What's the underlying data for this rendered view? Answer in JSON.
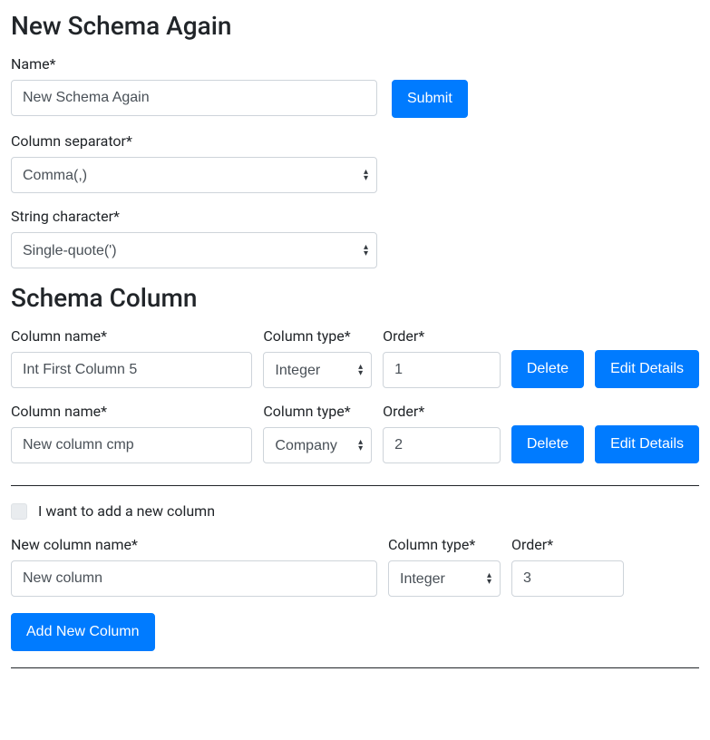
{
  "header": {
    "title": "New Schema Again"
  },
  "form": {
    "name_label": "Name*",
    "name_value": "New Schema Again",
    "submit_label": "Submit",
    "column_separator_label": "Column separator*",
    "column_separator_value": "Comma(,)",
    "string_character_label": "String character*",
    "string_character_value": "Single-quote(')"
  },
  "schema_column": {
    "title": "Schema Column",
    "column_name_label": "Column name*",
    "column_type_label": "Column type*",
    "order_label": "Order*",
    "delete_label": "Delete",
    "edit_details_label": "Edit Details",
    "rows": [
      {
        "name": "Int First Column 5",
        "type": "Integer",
        "order": "1"
      },
      {
        "name": "New column cmp",
        "type": "Company",
        "order": "2"
      }
    ]
  },
  "new_column": {
    "checkbox_label": "I want to add a new column",
    "name_label": "New column name*",
    "name_value": "New column",
    "type_label": "Column type*",
    "type_value": "Integer",
    "order_label": "Order*",
    "order_value": "3",
    "add_button_label": "Add New Column"
  }
}
